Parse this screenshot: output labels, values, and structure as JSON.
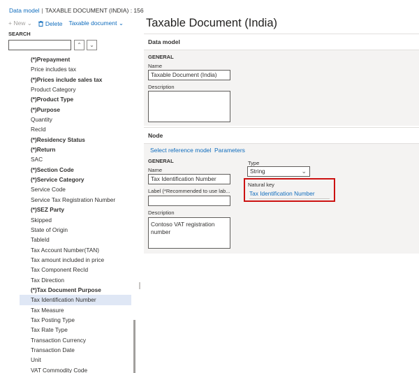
{
  "breadcrumb": {
    "root": "Data model",
    "separator": "|",
    "current": "TAXABLE DOCUMENT (INDIA) : 156"
  },
  "toolbar": {
    "new_label": "New",
    "delete_label": "Delete",
    "taxable_document_label": "Taxable document"
  },
  "search": {
    "label": "SEARCH",
    "value": "",
    "placeholder": ""
  },
  "tree": {
    "items": [
      {
        "label": "(*)Prepayment",
        "bold": true
      },
      {
        "label": "Price includes tax",
        "bold": false
      },
      {
        "label": "(*)Prices include sales tax",
        "bold": true
      },
      {
        "label": "Product Category",
        "bold": false
      },
      {
        "label": "(*)Product Type",
        "bold": true
      },
      {
        "label": "(*)Purpose",
        "bold": true
      },
      {
        "label": "Quantity",
        "bold": false
      },
      {
        "label": "RecId",
        "bold": false
      },
      {
        "label": "(*)Residency Status",
        "bold": true
      },
      {
        "label": "(*)Return",
        "bold": true
      },
      {
        "label": "SAC",
        "bold": false
      },
      {
        "label": "(*)Section Code",
        "bold": true
      },
      {
        "label": "(*)Service Category",
        "bold": true
      },
      {
        "label": "Service Code",
        "bold": false
      },
      {
        "label": "Service Tax Registration Number",
        "bold": false
      },
      {
        "label": "(*)SEZ Party",
        "bold": true
      },
      {
        "label": "Skipped",
        "bold": false
      },
      {
        "label": "State of Origin",
        "bold": false
      },
      {
        "label": "TableId",
        "bold": false
      },
      {
        "label": "Tax Account Number(TAN)",
        "bold": false
      },
      {
        "label": "Tax amount included in price",
        "bold": false
      },
      {
        "label": "Tax Component RecId",
        "bold": false
      },
      {
        "label": "Tax Direction",
        "bold": false
      },
      {
        "label": "(*)Tax Document Purpose",
        "bold": true
      },
      {
        "label": "Tax Identification Number",
        "bold": false,
        "selected": true
      },
      {
        "label": "Tax Measure",
        "bold": false
      },
      {
        "label": "Tax Posting Type",
        "bold": false
      },
      {
        "label": "Tax Rate Type",
        "bold": false
      },
      {
        "label": "Transaction Currency",
        "bold": false
      },
      {
        "label": "Transaction Date",
        "bold": false
      },
      {
        "label": "Unit",
        "bold": false
      },
      {
        "label": "VAT Commodity Code",
        "bold": false
      }
    ]
  },
  "page": {
    "title": "Taxable Document (India)"
  },
  "data_model_section": {
    "header": "Data model",
    "group_header": "GENERAL",
    "name_label": "Name",
    "name_value": "Taxable Document (India)",
    "description_label": "Description",
    "description_value": ""
  },
  "node_section": {
    "header": "Node",
    "tab_select_reference_model": "Select reference model",
    "tab_parameters": "Parameters",
    "group_header": "GENERAL",
    "name_label": "Name",
    "name_value": "Tax Identification Number",
    "label_label": "Label (*Recommended to use lab...",
    "label_value": "",
    "description_label": "Description",
    "description_value": "Contoso VAT registration number",
    "type_label": "Type",
    "type_value": "String",
    "natural_key_label": "Natural key",
    "natural_key_value": "Tax Identification Number"
  },
  "colors": {
    "accent": "#0f6cbd",
    "highlight": "#cc1111",
    "selected_row": "#dfe7f5",
    "panel_bg": "#f4f3f2"
  }
}
